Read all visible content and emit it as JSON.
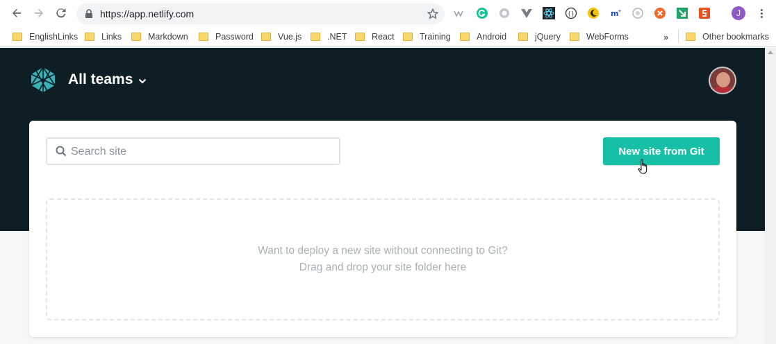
{
  "browser": {
    "url": "https://app.netlify.com",
    "extensions": [
      "wappalyzer-icon",
      "grammarly-icon",
      "chrome-ext-icon",
      "vue-devtools-icon",
      "react-devtools-icon",
      "json-viewer-icon",
      "dark-reader-icon",
      "ext-m-icon",
      "ext-circle-icon",
      "ext-orange-icon",
      "ext-green-icon",
      "ext-red-icon"
    ],
    "profile_initial": "J"
  },
  "bookmarks": {
    "items": [
      {
        "label": "EnglishLinks"
      },
      {
        "label": "Links"
      },
      {
        "label": "Markdown"
      },
      {
        "label": "Password"
      },
      {
        "label": "Vue.js"
      },
      {
        "label": ".NET"
      },
      {
        "label": "React"
      },
      {
        "label": "Training"
      },
      {
        "label": "Android"
      },
      {
        "label": "jQuery"
      },
      {
        "label": "WebForms"
      }
    ],
    "more": "»",
    "other": "Other bookmarks"
  },
  "header": {
    "team_label": "All teams"
  },
  "sites": {
    "search_placeholder": "Search site",
    "new_site_label": "New site from Git",
    "drop_line1": "Want to deploy a new site without connecting to Git?",
    "drop_line2": "Drag and drop your site folder here"
  },
  "colors": {
    "header_bg": "#0e1e25",
    "accent": "#16bfa6"
  }
}
